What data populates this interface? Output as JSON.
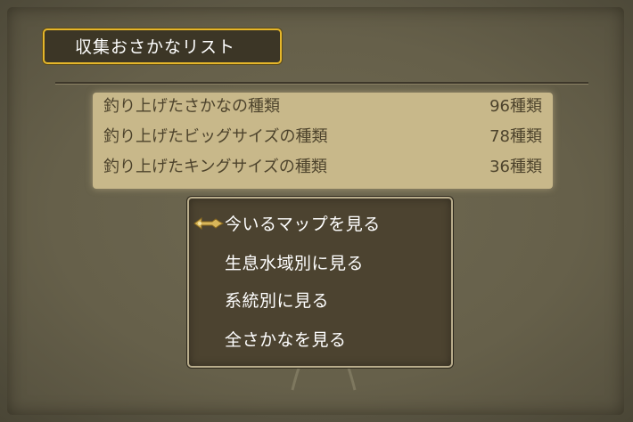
{
  "title": "収集おさかなリスト",
  "stats": [
    {
      "label": "釣り上げたさかなの種類",
      "value": "96種類"
    },
    {
      "label": "釣り上げたビッグサイズの種類",
      "value": "78種類"
    },
    {
      "label": "釣り上げたキングサイズの種類",
      "value": "36種類"
    }
  ],
  "menu": {
    "items": [
      {
        "label": "今いるマップを見る"
      },
      {
        "label": "生息水域別に見る"
      },
      {
        "label": "系統別に見る"
      },
      {
        "label": "全さかなを見る"
      }
    ],
    "selected_index": 0
  },
  "colors": {
    "title_border": "#e5b62a",
    "stats_background": "#c8b88a",
    "menu_background": "#4c4330",
    "cursor": "#d8b65a"
  },
  "icons": {
    "cursor": "hand-pointer-icon"
  }
}
